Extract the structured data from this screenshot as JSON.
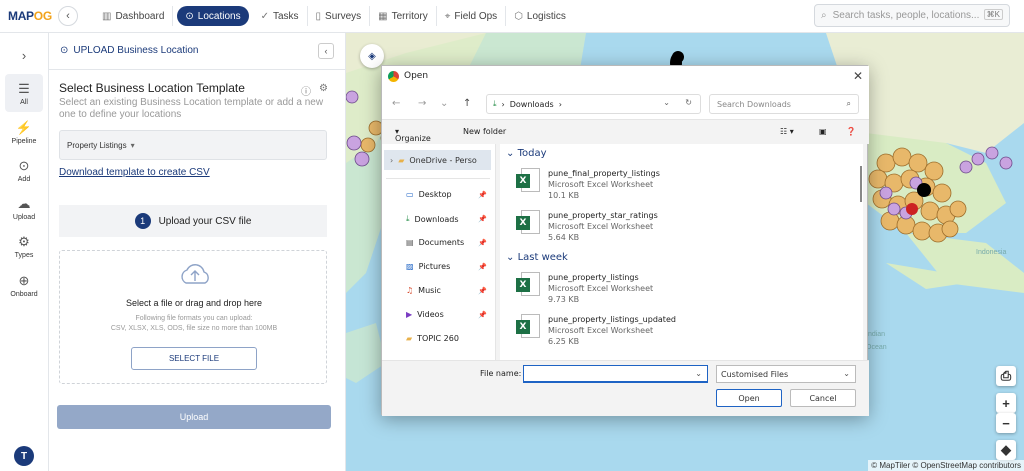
{
  "topbar": {
    "logo_a": "MAP",
    "logo_b": "OG",
    "search_placeholder": "Search tasks, people, locations...",
    "shortcut": "⌘K",
    "nav": [
      {
        "label": "Dashboard",
        "icon": "dashboard-icon",
        "glyph": "▥"
      },
      {
        "label": "Locations",
        "icon": "location-pin-icon",
        "glyph": "⊙"
      },
      {
        "label": "Tasks",
        "icon": "check-icon",
        "glyph": "✓"
      },
      {
        "label": "Surveys",
        "icon": "clipboard-icon",
        "glyph": "▯"
      },
      {
        "label": "Territory",
        "icon": "map-icon",
        "glyph": "▦"
      },
      {
        "label": "Field Ops",
        "icon": "route-icon",
        "glyph": "⌖"
      },
      {
        "label": "Logistics",
        "icon": "box-icon",
        "glyph": "⬡"
      }
    ]
  },
  "rail": {
    "toggle": "›",
    "items": [
      {
        "label": "All",
        "glyph": "☰"
      },
      {
        "label": "Pipeline",
        "glyph": "⚡"
      },
      {
        "label": "Add",
        "glyph": "⊙"
      },
      {
        "label": "Upload",
        "glyph": "☁"
      },
      {
        "label": "Types",
        "glyph": "⚙"
      },
      {
        "label": "Onboard",
        "glyph": "⊕"
      }
    ],
    "avatar": "T"
  },
  "panel": {
    "title": "UPLOAD Business Location",
    "heading": "Select Business Location Template",
    "subtitle": "Select an existing Business Location template or add a new one to define your locations",
    "template_value": "Property Listings",
    "download_link": "Download template to create CSV",
    "step_num": "1",
    "step_label": "Upload your CSV file",
    "drop_title": "Select a file or drag and drop here",
    "drop_hint_1": "Following file formats you can upload:",
    "drop_hint_2": "CSV, XLSX, XLS, ODS, file size no more than 100MB",
    "select_file": "SELECT FILE",
    "upload": "Upload"
  },
  "map": {
    "attribution": "© MapTiler © OpenStreetMap contributors",
    "labels": [
      "Indonesia",
      "Indian",
      "Ocean"
    ]
  },
  "dialog": {
    "title": "Open",
    "path": "Downloads",
    "search_placeholder": "Search Downloads",
    "organize": "Organize",
    "new_folder": "New folder",
    "nav_items": [
      {
        "label": "OneDrive - Perso",
        "icon": "folder-icon"
      },
      {
        "label": "Desktop",
        "icon": "desktop-icon"
      },
      {
        "label": "Downloads",
        "icon": "download-icon"
      },
      {
        "label": "Documents",
        "icon": "document-icon"
      },
      {
        "label": "Pictures",
        "icon": "picture-icon"
      },
      {
        "label": "Music",
        "icon": "music-icon"
      },
      {
        "label": "Videos",
        "icon": "video-icon"
      },
      {
        "label": "TOPIC 260",
        "icon": "folder-icon"
      }
    ],
    "groups": [
      {
        "name": "Today",
        "files": [
          {
            "name": "pune_final_property_listings",
            "type": "Microsoft Excel Worksheet",
            "size": "10.1 KB"
          },
          {
            "name": "pune_property_star_ratings",
            "type": "Microsoft Excel Worksheet",
            "size": "5.64 KB"
          }
        ]
      },
      {
        "name": "Last week",
        "files": [
          {
            "name": "pune_property_listings",
            "type": "Microsoft Excel Worksheet",
            "size": "9.73 KB"
          },
          {
            "name": "pune_property_listings_updated",
            "type": "Microsoft Excel Worksheet",
            "size": "6.25 KB"
          }
        ]
      }
    ],
    "file_name_label": "File name:",
    "file_name_value": "",
    "file_type": "Customised Files",
    "open": "Open",
    "cancel": "Cancel"
  },
  "colors": {
    "brand": "#1b3a7a",
    "accent": "#f2a31b",
    "excel": "#1d7045"
  }
}
